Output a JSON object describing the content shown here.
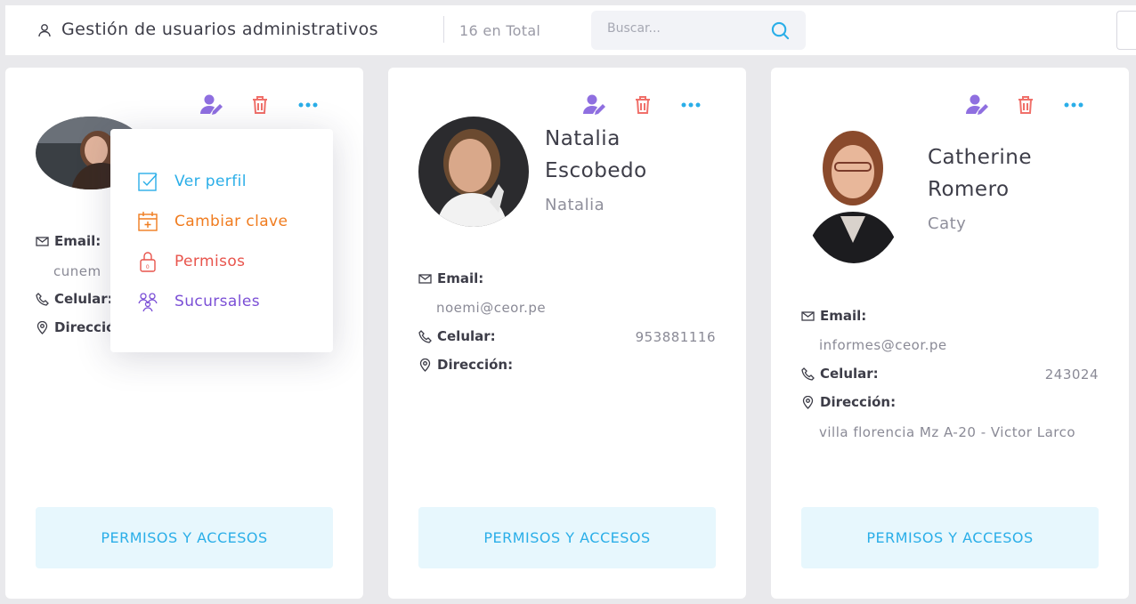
{
  "header": {
    "title": "Gestión de usuarios administrativos",
    "total": "16 en Total",
    "search_placeholder": "Buscar..."
  },
  "labels": {
    "email": "Email:",
    "phone": "Celular:",
    "address": "Dirección:",
    "permissions_button": "PERMISOS Y ACCESOS"
  },
  "dropdown": {
    "items": [
      {
        "label": "Ver perfil",
        "color": "#2aaee8",
        "icon": "check-square-icon"
      },
      {
        "label": "Cambiar clave",
        "color": "#f07c1f",
        "icon": "calendar-plus-icon"
      },
      {
        "label": "Permisos",
        "color": "#e8544c",
        "icon": "lock-icon"
      },
      {
        "label": "Sucursales",
        "color": "#7b4fd6",
        "icon": "users-branch-icon"
      }
    ]
  },
  "cards": [
    {
      "name_line1": "",
      "name_line2": "",
      "nick": "",
      "email": "cunem",
      "phone": "",
      "address": ""
    },
    {
      "name_line1": "Natalia",
      "name_line2": "Escobedo",
      "nick": "Natalia",
      "email": "noemi@ceor.pe",
      "phone": "953881116",
      "address": ""
    },
    {
      "name_line1": "Catherine",
      "name_line2": "Romero",
      "nick": "Caty",
      "email": "informes@ceor.pe",
      "phone": "243024",
      "address": "villa florencia Mz A-20 - Victor Larco"
    }
  ],
  "colors": {
    "accent_blue": "#2aaee8",
    "edit_purple": "#8f6fe0",
    "delete_red": "#f0706a",
    "more_blue": "#2aaee8"
  }
}
